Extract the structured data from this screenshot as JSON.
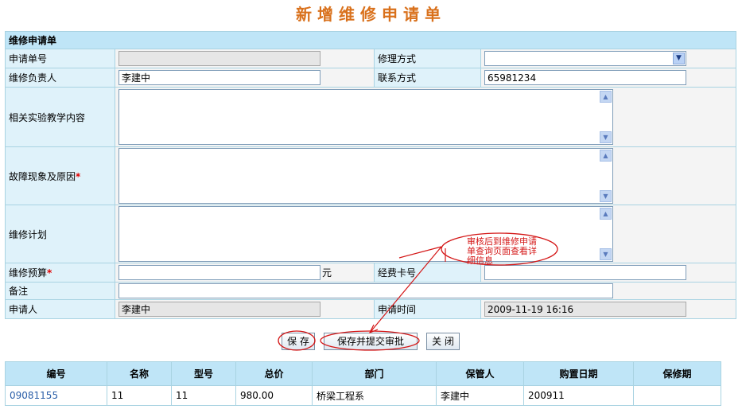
{
  "page_title": "新增维修申请单",
  "form": {
    "section_title": "维修申请单",
    "request_no": {
      "label": "申请单号",
      "value": ""
    },
    "repair_method": {
      "label": "修理方式",
      "value": ""
    },
    "repair_owner": {
      "label": "维修负责人",
      "value": "李建中"
    },
    "contact": {
      "label": "联系方式",
      "value": "65981234"
    },
    "teaching_content": {
      "label": "相关实验教学内容",
      "value": ""
    },
    "fault": {
      "label": "故障现象及原因",
      "required_mark": "*",
      "value": ""
    },
    "plan": {
      "label": "维修计划",
      "value": ""
    },
    "budget": {
      "label": "维修预算",
      "required_mark": "*",
      "value": "",
      "unit": "元"
    },
    "funding_card": {
      "label": "经费卡号",
      "value": ""
    },
    "remarks": {
      "label": "备注",
      "value": ""
    },
    "applicant": {
      "label": "申请人",
      "value": "李建中"
    },
    "apply_time": {
      "label": "申请时间",
      "value": "2009-11-19 16:16"
    }
  },
  "buttons": {
    "save": "保 存",
    "save_submit": "保存并提交审批",
    "close": "关 闭"
  },
  "annotation": {
    "text": "审核后到维修申请单查询页面查看详细信息",
    "color": "#d41616"
  },
  "table": {
    "headers": [
      "编号",
      "名称",
      "型号",
      "总价",
      "部门",
      "保管人",
      "购置日期",
      "保修期"
    ],
    "rows": [
      [
        "09081155",
        "11",
        "11",
        "980.00",
        "桥梁工程系",
        "李建中",
        "200911",
        ""
      ]
    ]
  },
  "colors": {
    "title": "#d9711c",
    "section_bg": "#bfe5f7",
    "label_bg": "#dff2fa",
    "border": "#a9d3e2",
    "link": "#2a5ea8",
    "required": "#e00000"
  },
  "icons": {
    "dropdown": "chevron-down-icon",
    "scroll_up": "scroll-up-icon",
    "scroll_down": "scroll-down-icon"
  }
}
